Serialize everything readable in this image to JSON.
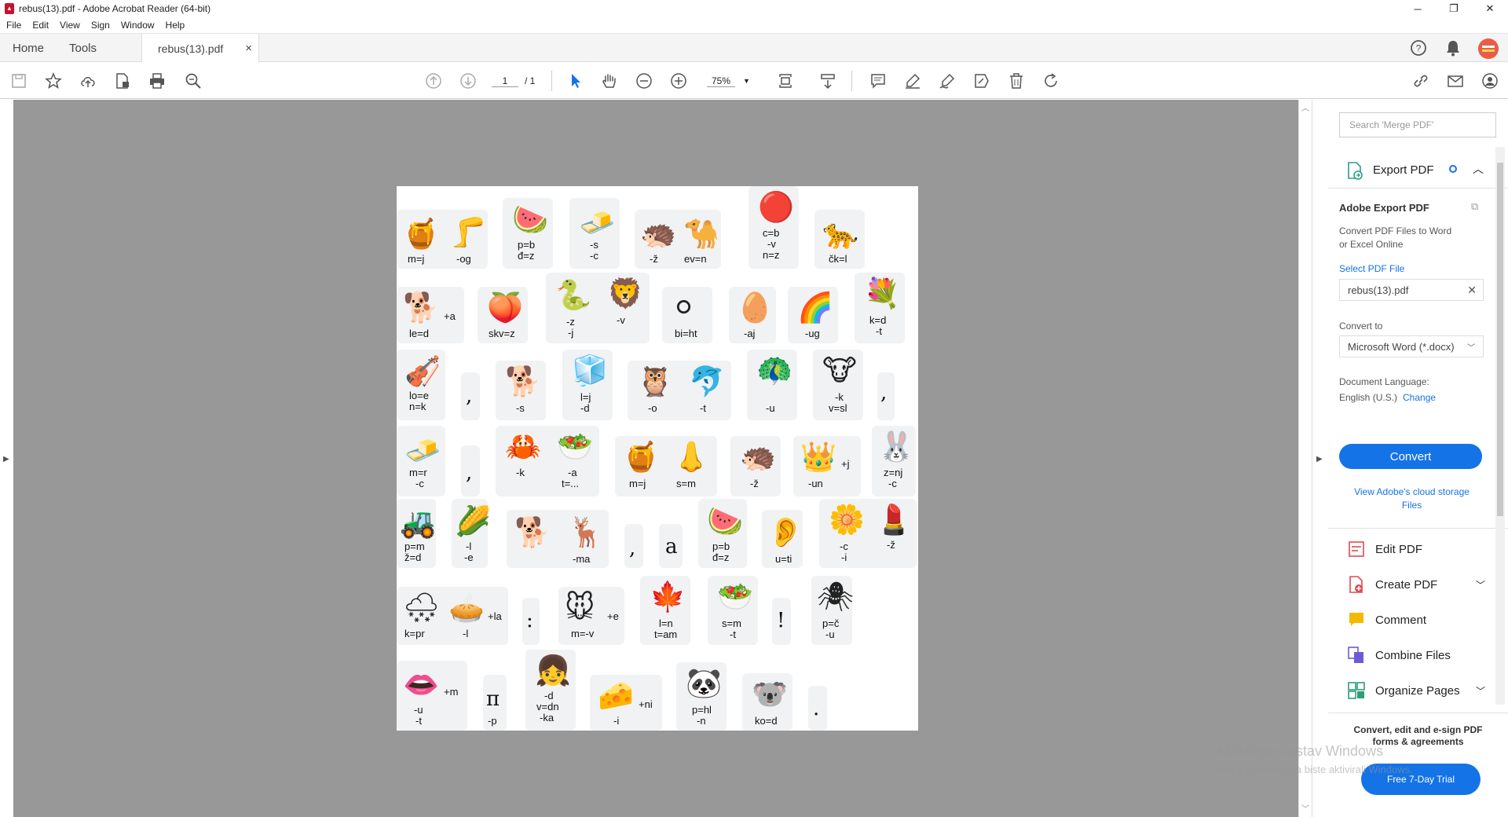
{
  "window": {
    "title": "rebus(13).pdf - Adobe Acrobat Reader (64-bit)",
    "minimize": "─",
    "maximize": "❐",
    "close": "✕"
  },
  "menu": [
    "File",
    "Edit",
    "View",
    "Sign",
    "Window",
    "Help"
  ],
  "tabs": {
    "home": "Home",
    "tools": "Tools",
    "document": "rebus(13).pdf",
    "close": "×"
  },
  "toolbar": {
    "page_current": "1",
    "page_total": "/ 1",
    "zoom": "75%"
  },
  "panel": {
    "search_placeholder": "Search 'Merge PDF'",
    "export_title": "Export PDF",
    "adobe_export_title": "Adobe Export PDF",
    "export_desc1": "Convert PDF Files to Word",
    "export_desc2": "or Excel Online",
    "select_file": "Select PDF File",
    "file_name": "rebus(13).pdf",
    "convert_to": "Convert to",
    "format": "Microsoft Word (*.docx)",
    "doc_language": "Document Language:",
    "language": "English (U.S.)",
    "change": "Change",
    "convert_btn": "Convert",
    "cloud_link1": "View Adobe's cloud storage",
    "cloud_link2": "Files",
    "tools": [
      "Edit PDF",
      "Create PDF",
      "Comment",
      "Combine Files",
      "Organize Pages"
    ],
    "promo1": "Convert, edit and e-sign PDF",
    "promo2": "forms & agreements",
    "trial_btn": "Free 7-Day Trial"
  },
  "watermark": {
    "line1": "Aktivirajte sustav Windows",
    "line2": "Idite u postavke da biste aktivirali Windows."
  },
  "rebus": {
    "r1": {
      "a_emoji": "🍯",
      "a_lbl": "m=j",
      "b_emoji": "🦵",
      "b_lbl": "-og",
      "c_emoji": "🍉",
      "c_l1": "p=b",
      "c_l2": "đ=z",
      "d_emoji": "🧈",
      "d_l1": "-s",
      "d_l2": "-c",
      "e_emoji": "🦔",
      "e_lbl": "-ž",
      "f_emoji": "🐪",
      "f_lbl": "ev=n",
      "g_emoji": "🔴",
      "g_l1": "c=b",
      "g_l2": "-v",
      "g_l3": "n=z",
      "h_emoji": "🐆",
      "h_lbl": "čk=l"
    },
    "r2": {
      "a_emoji": "🐕",
      "a_add": "+a",
      "a_lbl": "le=d",
      "b_emoji": "🍑",
      "b_lbl": "skv=z",
      "c_emoji": "🐍",
      "c_l1": "-z",
      "c_l2": "-j",
      "d_emoji": "🦁",
      "d_lbl": "-v",
      "e_emoji": "⚪",
      "e_lbl": "bi=ht",
      "f_emoji": "🥚",
      "f_lbl": "-aj",
      "g_emoji": "🌈",
      "g_lbl": "-ug",
      "h_emoji": "💐",
      "h_l1": "k=d",
      "h_l2": "-t"
    },
    "r3": {
      "a_emoji": "🎻",
      "a_l1": "lo=e",
      "a_l2": "n=k",
      "comma1": ",",
      "b_emoji": "🐕",
      "b_lbl": "-s",
      "c_emoji": "🧊",
      "c_l1": "l=j",
      "c_l2": "-d",
      "d_emoji": "🦉",
      "d_lbl": "-o",
      "e_emoji": "🐬",
      "e_lbl": "-t",
      "f_emoji": "🦚",
      "f_l1": "p=d",
      "f_l2": "-u",
      "g_emoji": "🐮",
      "g_l1": "-k",
      "g_l2": "v=sl",
      "comma2": ","
    },
    "r4": {
      "a_emoji": "🧈",
      "a_l1": "m=r",
      "a_l2": "-c",
      "comma": ",",
      "b_emoji": "🦀",
      "b_lbl": "-k",
      "c_emoji": "🥗",
      "c_l1": "-a",
      "c_l2": "t=...",
      "d_emoji": "🍯",
      "d_lbl": "m=j",
      "e_emoji": "👃",
      "e_lbl": "s=m",
      "f_emoji": "🦔",
      "f_lbl": "-ž",
      "g_emoji": "👑",
      "g_add": "+j",
      "g_lbl": "-un",
      "h_emoji": "🐰",
      "h_l1": "z=nj",
      "h_l2": "-c"
    },
    "r5": {
      "a_emoji": "🚜",
      "a_l1": "p=m",
      "a_l2": "ž=d",
      "b_emoji": "🌽",
      "b_l1": "-l",
      "b_l2": "-e",
      "c_emoji": "🐕",
      "d_emoji": "🦌",
      "d_lbl": "-ma",
      "comma": ",",
      "letter": "a",
      "e_emoji": "🍉",
      "e_l1": "p=b",
      "e_l2": "đ=z",
      "f_emoji": "👂",
      "f_lbl": "u=ti",
      "g_emoji": "🌼",
      "g_l1": "-c",
      "g_l2": "-i",
      "h_emoji": "💄",
      "h_lbl": "-ž"
    },
    "r6": {
      "a_emoji": "🌨",
      "a_lbl": "k=pr",
      "b_emoji": "🥧",
      "b_add": "+la",
      "b_lbl": "-l",
      "colon": ":",
      "c_emoji": "🐭",
      "c_add": "+e",
      "c_lbl": "m=-v",
      "d_emoji": "🍁",
      "d_l1": "l=n",
      "d_l2": "t=am",
      "e_emoji": "🥗",
      "e_l1": "s=m",
      "e_l2": "-t",
      "excl": "!",
      "f_emoji": "🕷",
      "f_l1": "p=č",
      "f_l2": "-u"
    },
    "r7": {
      "a_emoji": "👄",
      "a_add": "+m",
      "a_l1": "-u",
      "a_l2": "-t",
      "b_emoji": "π",
      "b_lbl": "-p",
      "c_emoji": "👧",
      "c_l1": "-d",
      "c_l2": "v=dn",
      "c_l3": "-ka",
      "d_emoji": "🧀",
      "d_add": "+ni",
      "d_lbl": "-i",
      "e_emoji": "🐼",
      "e_l1": "p=hl",
      "e_l2": "-n",
      "f_emoji": "🐨",
      "f_lbl": "ko=d",
      "dot": "."
    }
  }
}
